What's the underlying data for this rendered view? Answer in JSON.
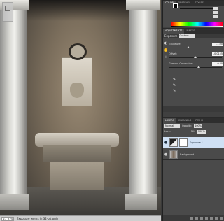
{
  "status_bar": {
    "zoom": "33.33%",
    "info": "Exposure works in 32-bit only"
  },
  "color_panel": {
    "tabs": [
      "Color",
      "Swatches",
      "Styles"
    ],
    "foreground": "#000000",
    "background": "#ffffff"
  },
  "adjustments": {
    "tabs": [
      "Adjustments",
      "Masks"
    ],
    "title": "Exposure",
    "preset_label": "Custom",
    "rows": [
      {
        "label": "Exposure:",
        "value": "-1.00",
        "level": 0.35
      },
      {
        "label": "Offset:",
        "value": "-0.0155",
        "level": 0.48
      },
      {
        "label": "Gamma Correction:",
        "value": "0.80",
        "level": 0.56
      }
    ],
    "icons": [
      "exposure-icon",
      "hand-icon",
      "add-icon",
      "eyedropper-icon"
    ]
  },
  "layers": {
    "tabs": [
      "Layers",
      "Channels",
      "Paths"
    ],
    "blend_mode": "Normal",
    "opacity_label": "Opacity:",
    "opacity_value": "100%",
    "lock_label": "Lock:",
    "fill_label": "Fill:",
    "fill_value": "100%",
    "items": [
      {
        "name": "Exposure 1",
        "selected": true
      },
      {
        "name": "Background",
        "selected": false
      }
    ]
  }
}
